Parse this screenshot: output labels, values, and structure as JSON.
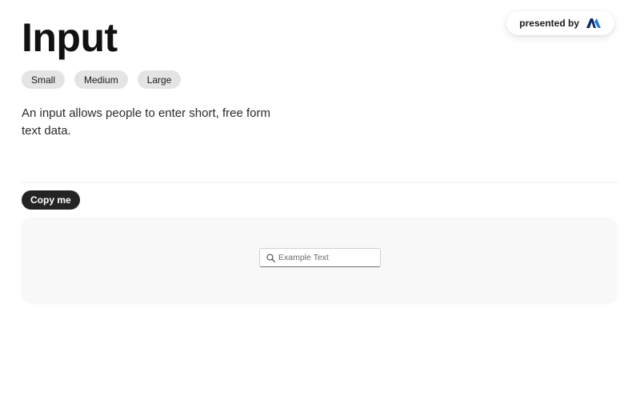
{
  "header": {
    "title": "Input",
    "presented_by": "presented by",
    "logo": "brand-logo-icon"
  },
  "sizes": {
    "items": [
      {
        "label": "Small"
      },
      {
        "label": "Medium"
      },
      {
        "label": "Large"
      }
    ]
  },
  "description": "An input allows people to enter short, free form text data.",
  "actions": {
    "copy_label": "Copy me"
  },
  "preview": {
    "input": {
      "placeholder": "Example Text",
      "value": "",
      "icon": "search-icon"
    }
  },
  "colors": {
    "chip_background": "#e4e4e4",
    "copy_button": "#242424",
    "preview_background": "#f8f8f8",
    "logo_dark": "#0b2a5b",
    "logo_accent": "#2f7de1"
  }
}
